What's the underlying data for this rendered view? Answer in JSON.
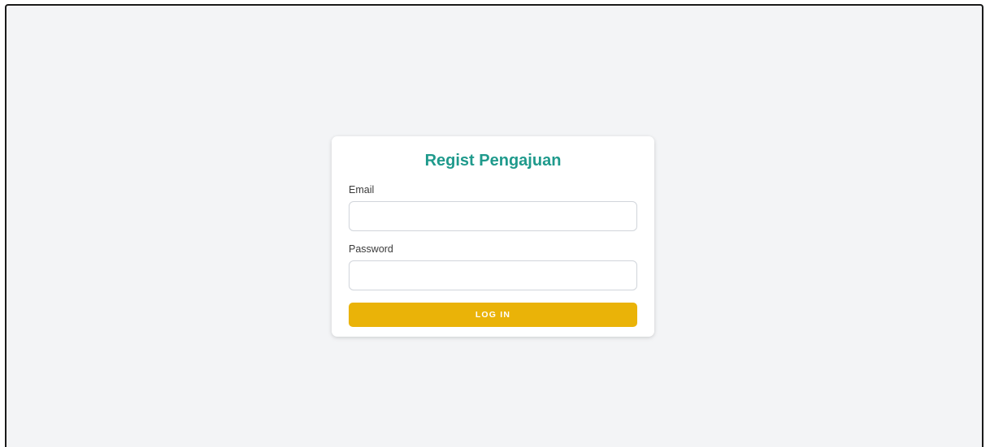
{
  "login_form": {
    "title": "Regist Pengajuan",
    "email_label": "Email",
    "email_value": "",
    "password_label": "Password",
    "password_value": "",
    "login_button": "LOG IN"
  },
  "colors": {
    "background": "#f3f4f6",
    "title": "#1f9a8c",
    "button": "#eab308",
    "button_text": "#ffffff"
  }
}
